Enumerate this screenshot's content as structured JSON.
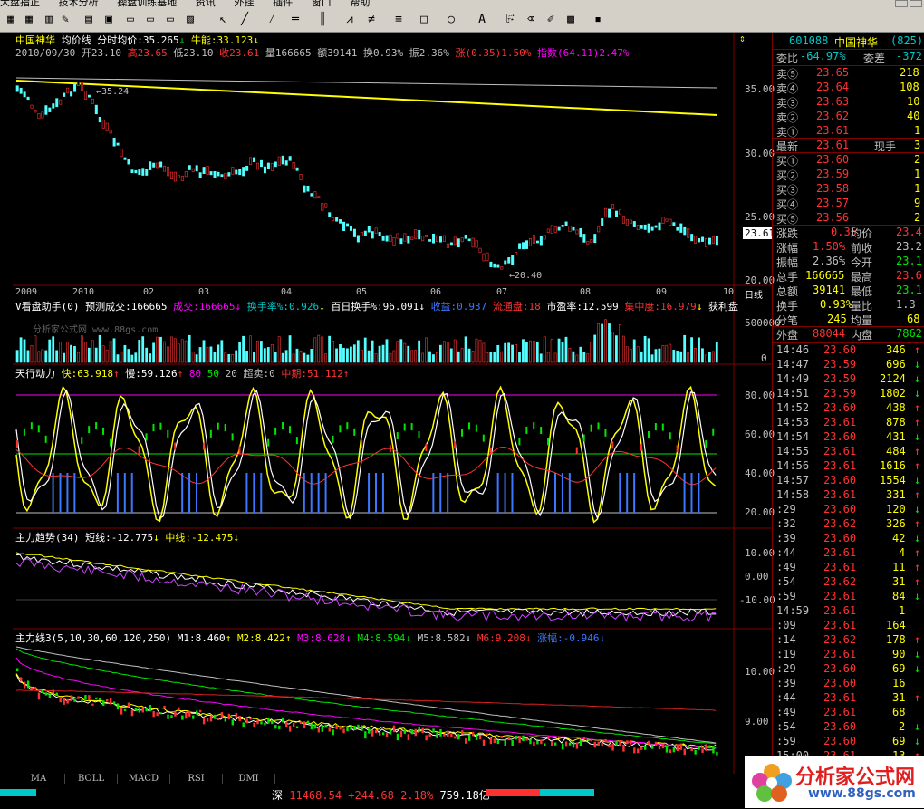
{
  "menu": [
    "大盘指正",
    "技术分析",
    "操盘训练基地",
    "资讯",
    "外挂",
    "插件",
    "窗口",
    "帮助"
  ],
  "chart": {
    "title_name": "中国神华",
    "title_mode": "均价线",
    "title_avg": "分时均价:35.265",
    "title_bull": "牛能:33.123",
    "info_date": "2010/09/30",
    "info_open": "开23.10",
    "info_high": "高23.65",
    "info_low": "低23.10",
    "info_close": "收23.61",
    "info_vol": "量166665",
    "info_amt": "额39141",
    "info_turn": "换0.93%",
    "info_amp": "振2.36%",
    "info_chg": "涨(0.35)1.50%",
    "info_idx": "指数(64.11)2.47%",
    "high_mark": "35.24",
    "low_mark": "20.40",
    "price_axis": [
      "35.00",
      "30.00",
      "25.00",
      "20.00"
    ],
    "current_price": "23.61",
    "x_axis": [
      "2009",
      "2010",
      "02",
      "03",
      "04",
      "05",
      "06",
      "07",
      "08",
      "09",
      "10"
    ],
    "period": "日线"
  },
  "vol_pane": {
    "title": "V看盘助手(0)",
    "pred": "预测成交:166665",
    "vol": "成交:166665",
    "turn": "换手率%:0.926",
    "hundred": "百日换手%:96.091",
    "cost": "收益:0.937",
    "float": "流通盘:18",
    "pe": "市盈率:12.599",
    "conc": "集中度:16.979",
    "profit": "获利盘",
    "axis": [
      "500000",
      "0"
    ],
    "watermark": "分析家公式网 www.88gs.com"
  },
  "tianxing": {
    "title": "天行动力",
    "fast": "快:63.918",
    "slow": "慢:59.126",
    "v80": "80",
    "v50": "50",
    "v20": "20",
    "over": "超卖:0",
    "mid": "中期:51.112",
    "axis": [
      "80.00",
      "60.00",
      "40.00",
      "20.00"
    ]
  },
  "trend": {
    "title": "主力趋势(34)",
    "short": "短线:-12.775",
    "mid": "中线:-12.475",
    "axis": [
      "10.00",
      "0.00",
      "-10.00"
    ]
  },
  "zhuli": {
    "title": "主力线3(5,10,30,60,120,250)",
    "m1": "M1:8.460",
    "m2": "M2:8.422",
    "m3": "M3:8.628",
    "m4": "M4:8.594",
    "m5": "M5:8.582",
    "m6": "M6:9.208",
    "zf": "涨幅:-0.946",
    "axis": [
      "10.00",
      "9.00"
    ]
  },
  "tabs": [
    "MA",
    "BOLL",
    "MACD",
    "RSI",
    "DMI"
  ],
  "quote": {
    "code": "601088",
    "name": "中国神华",
    "num": "(825)",
    "wei_bi": "委比",
    "wei_bi_val": "-64.97%",
    "wei_cha": "委差",
    "wei_cha_val": "-372",
    "asks": [
      {
        "label": "卖⑤",
        "price": "23.65",
        "vol": "218"
      },
      {
        "label": "卖④",
        "price": "23.64",
        "vol": "108"
      },
      {
        "label": "卖③",
        "price": "23.63",
        "vol": "10"
      },
      {
        "label": "卖②",
        "price": "23.62",
        "vol": "40"
      },
      {
        "label": "卖①",
        "price": "23.61",
        "vol": "1"
      }
    ],
    "last_label": "最新",
    "last_price": "23.61",
    "now_label": "现手",
    "now_vol": "3",
    "bids": [
      {
        "label": "买①",
        "price": "23.60",
        "vol": "2"
      },
      {
        "label": "买②",
        "price": "23.59",
        "vol": "1"
      },
      {
        "label": "买③",
        "price": "23.58",
        "vol": "1"
      },
      {
        "label": "买④",
        "price": "23.57",
        "vol": "9"
      },
      {
        "label": "买⑤",
        "price": "23.56",
        "vol": "2"
      }
    ],
    "stats": [
      {
        "k1": "涨跌",
        "v1": "0.35",
        "k2": "均价",
        "v2": "23.4"
      },
      {
        "k1": "涨幅",
        "v1": "1.50%",
        "k2": "前收",
        "v2": "23.2"
      },
      {
        "k1": "振幅",
        "v1": "2.36%",
        "k2": "今开",
        "v2": "23.1"
      },
      {
        "k1": "总手",
        "v1": "166665",
        "k2": "最高",
        "v2": "23.6"
      },
      {
        "k1": "总额",
        "v1": "39141",
        "k2": "最低",
        "v2": "23.1"
      },
      {
        "k1": "换手",
        "v1": "0.93%",
        "k2": "量比",
        "v2": "1.3"
      },
      {
        "k1": "分笔",
        "v1": "245",
        "k2": "均量",
        "v2": "68"
      }
    ],
    "outer_label": "外盘",
    "outer_val": "88044",
    "inner_label": "内盘",
    "inner_val": "7862",
    "ticks": [
      {
        "t": "14:46",
        "p": "23.60",
        "v": "346",
        "c": "r"
      },
      {
        "t": "14:47",
        "p": "23.59",
        "v": "696",
        "c": "g"
      },
      {
        "t": "14:49",
        "p": "23.59",
        "v": "2124",
        "c": "g"
      },
      {
        "t": "14:51",
        "p": "23.59",
        "v": "1802",
        "c": "g"
      },
      {
        "t": "14:52",
        "p": "23.60",
        "v": "438",
        "c": "r"
      },
      {
        "t": "14:53",
        "p": "23.61",
        "v": "878",
        "c": "r"
      },
      {
        "t": "14:54",
        "p": "23.60",
        "v": "431",
        "c": "g"
      },
      {
        "t": "14:55",
        "p": "23.61",
        "v": "484",
        "c": "r"
      },
      {
        "t": "14:56",
        "p": "23.61",
        "v": "1616",
        "c": "r"
      },
      {
        "t": "14:57",
        "p": "23.60",
        "v": "1554",
        "c": "g"
      },
      {
        "t": "14:58",
        "p": "23.61",
        "v": "331",
        "c": "r"
      },
      {
        "t": ":29",
        "p": "23.60",
        "v": "120",
        "c": "g"
      },
      {
        "t": ":32",
        "p": "23.62",
        "v": "326",
        "c": "r"
      },
      {
        "t": ":39",
        "p": "23.60",
        "v": "42",
        "c": "g"
      },
      {
        "t": ":44",
        "p": "23.61",
        "v": "4",
        "c": "r"
      },
      {
        "t": ":49",
        "p": "23.61",
        "v": "11",
        "c": "r"
      },
      {
        "t": ":54",
        "p": "23.62",
        "v": "31",
        "c": "r"
      },
      {
        "t": ":59",
        "p": "23.61",
        "v": "84",
        "c": "g"
      },
      {
        "t": "14:59",
        "p": "23.61",
        "v": "1",
        "c": ""
      },
      {
        "t": ":09",
        "p": "23.61",
        "v": "164",
        "c": ""
      },
      {
        "t": ":14",
        "p": "23.62",
        "v": "178",
        "c": "r"
      },
      {
        "t": ":19",
        "p": "23.61",
        "v": "90",
        "c": "g"
      },
      {
        "t": ":29",
        "p": "23.60",
        "v": "69",
        "c": "g"
      },
      {
        "t": ":39",
        "p": "23.60",
        "v": "16",
        "c": ""
      },
      {
        "t": ":44",
        "p": "23.61",
        "v": "31",
        "c": "r"
      },
      {
        "t": ":49",
        "p": "23.61",
        "v": "68",
        "c": ""
      },
      {
        "t": ":54",
        "p": "23.60",
        "v": "2",
        "c": "g"
      },
      {
        "t": ":59",
        "p": "23.60",
        "v": "69",
        "c": "g"
      },
      {
        "t": "15:00",
        "p": "23.61",
        "v": "13",
        "c": "r"
      }
    ]
  },
  "status": {
    "market": "深",
    "index": "11468.54",
    "change": "+244.68",
    "pct": "2.18%",
    "amount": "759.18亿"
  },
  "logo": {
    "text": "分析家公式网",
    "url": "www.88gs.com"
  }
}
